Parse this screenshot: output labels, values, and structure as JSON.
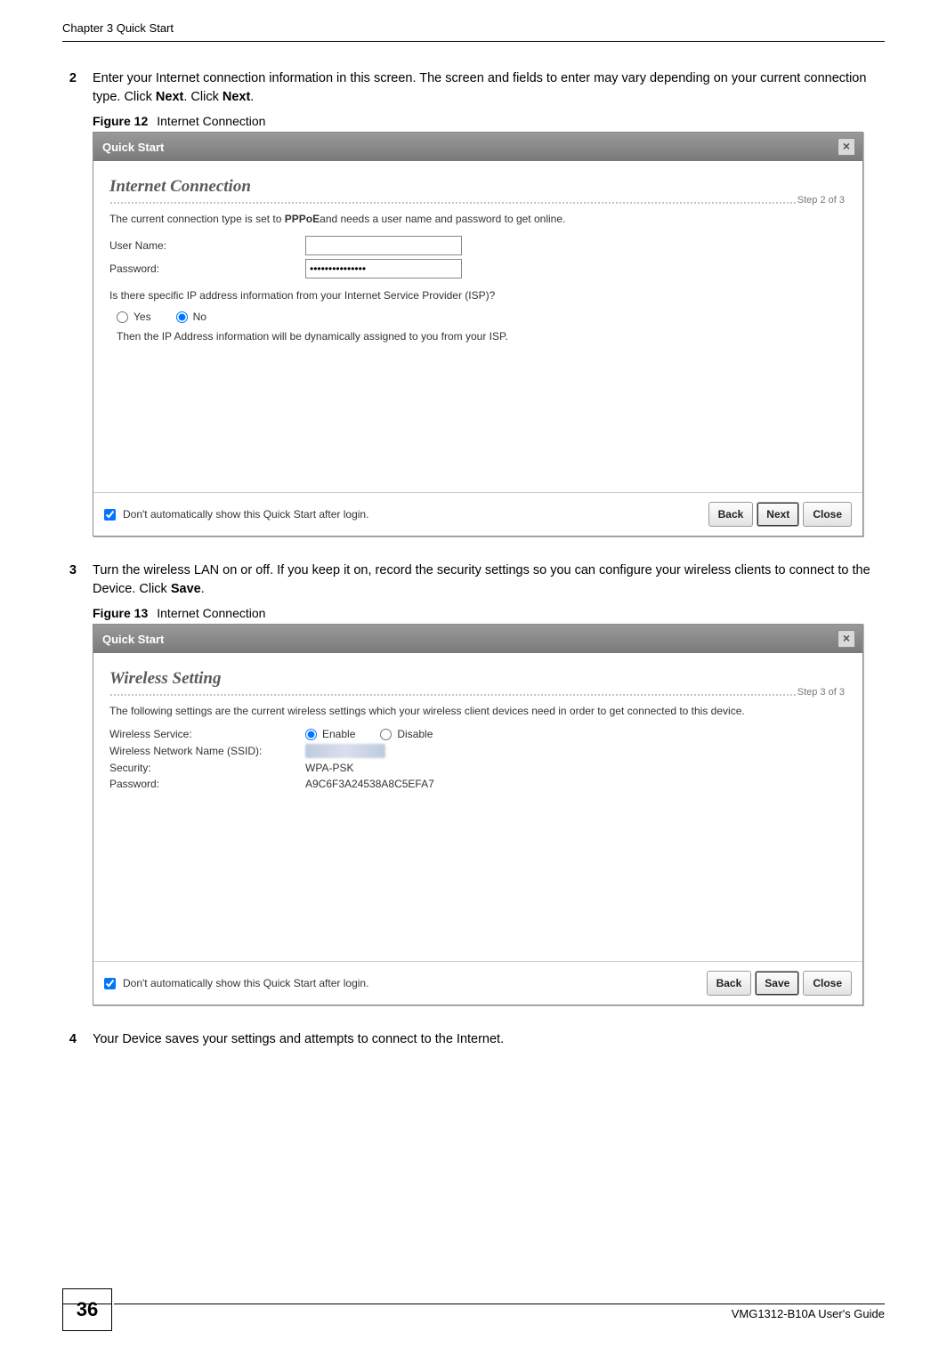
{
  "header": {
    "running": "Chapter 3 Quick Start"
  },
  "steps": {
    "s2": {
      "num": "2",
      "text_a": "Enter your Internet connection information in this screen. The screen and fields to enter may vary depending on your current connection type. Click ",
      "bold1": "Next",
      "mid": ". Click ",
      "bold2": "Next",
      "end": "."
    },
    "s3": {
      "num": "3",
      "text_a": "Turn the wireless LAN on or off. If you keep it on, record the security settings so you can configure your wireless clients to connect to the Device. Click ",
      "bold1": "Save",
      "end": "."
    },
    "s4": {
      "num": "4",
      "text": "Your Device saves your settings and attempts to connect to the Internet."
    }
  },
  "fig12": {
    "caption_label": "Figure 12",
    "caption_text": "Internet Connection",
    "dialog": {
      "titlebar": "Quick Start",
      "close": "×",
      "heading": "Internet Connection",
      "step_of": "Step 2 of 3",
      "intro_a": "The current connection type is set to ",
      "intro_bold": "PPPoE",
      "intro_b": "and needs a user name and password to get online.",
      "user_label": "User Name:",
      "user_value": "",
      "pass_label": "Password:",
      "pass_value": "•••••••••••••••",
      "isp_question": "Is there specific IP address information from your Internet Service Provider (ISP)?",
      "yes": "Yes",
      "no": "No",
      "no_selected": true,
      "then_text": "Then the IP Address information will be dynamically assigned to you from your ISP.",
      "dont_show": "Don't automatically show this Quick Start after login.",
      "dont_show_checked": true,
      "btn_back": "Back",
      "btn_next": "Next",
      "btn_close": "Close"
    }
  },
  "fig13": {
    "caption_label": "Figure 13",
    "caption_text": "Internet Connection",
    "dialog": {
      "titlebar": "Quick Start",
      "close": "×",
      "heading": "Wireless Setting",
      "step_of": "Step 3 of 3",
      "intro": "The following settings are the current wireless settings which your wireless client devices need in order to get connected to this device.",
      "service_label": "Wireless Service:",
      "enable": "Enable",
      "disable": "Disable",
      "enable_selected": true,
      "ssid_label": "Wireless Network Name (SSID):",
      "security_label": "Security:",
      "security_value": "WPA-PSK",
      "pass_label": "Password:",
      "pass_value": "A9C6F3A24538A8C5EFA7",
      "dont_show": "Don't automatically show this Quick Start after login.",
      "dont_show_checked": true,
      "btn_back": "Back",
      "btn_save": "Save",
      "btn_close": "Close"
    }
  },
  "footer": {
    "page": "36",
    "guide": "VMG1312-B10A User's Guide"
  }
}
